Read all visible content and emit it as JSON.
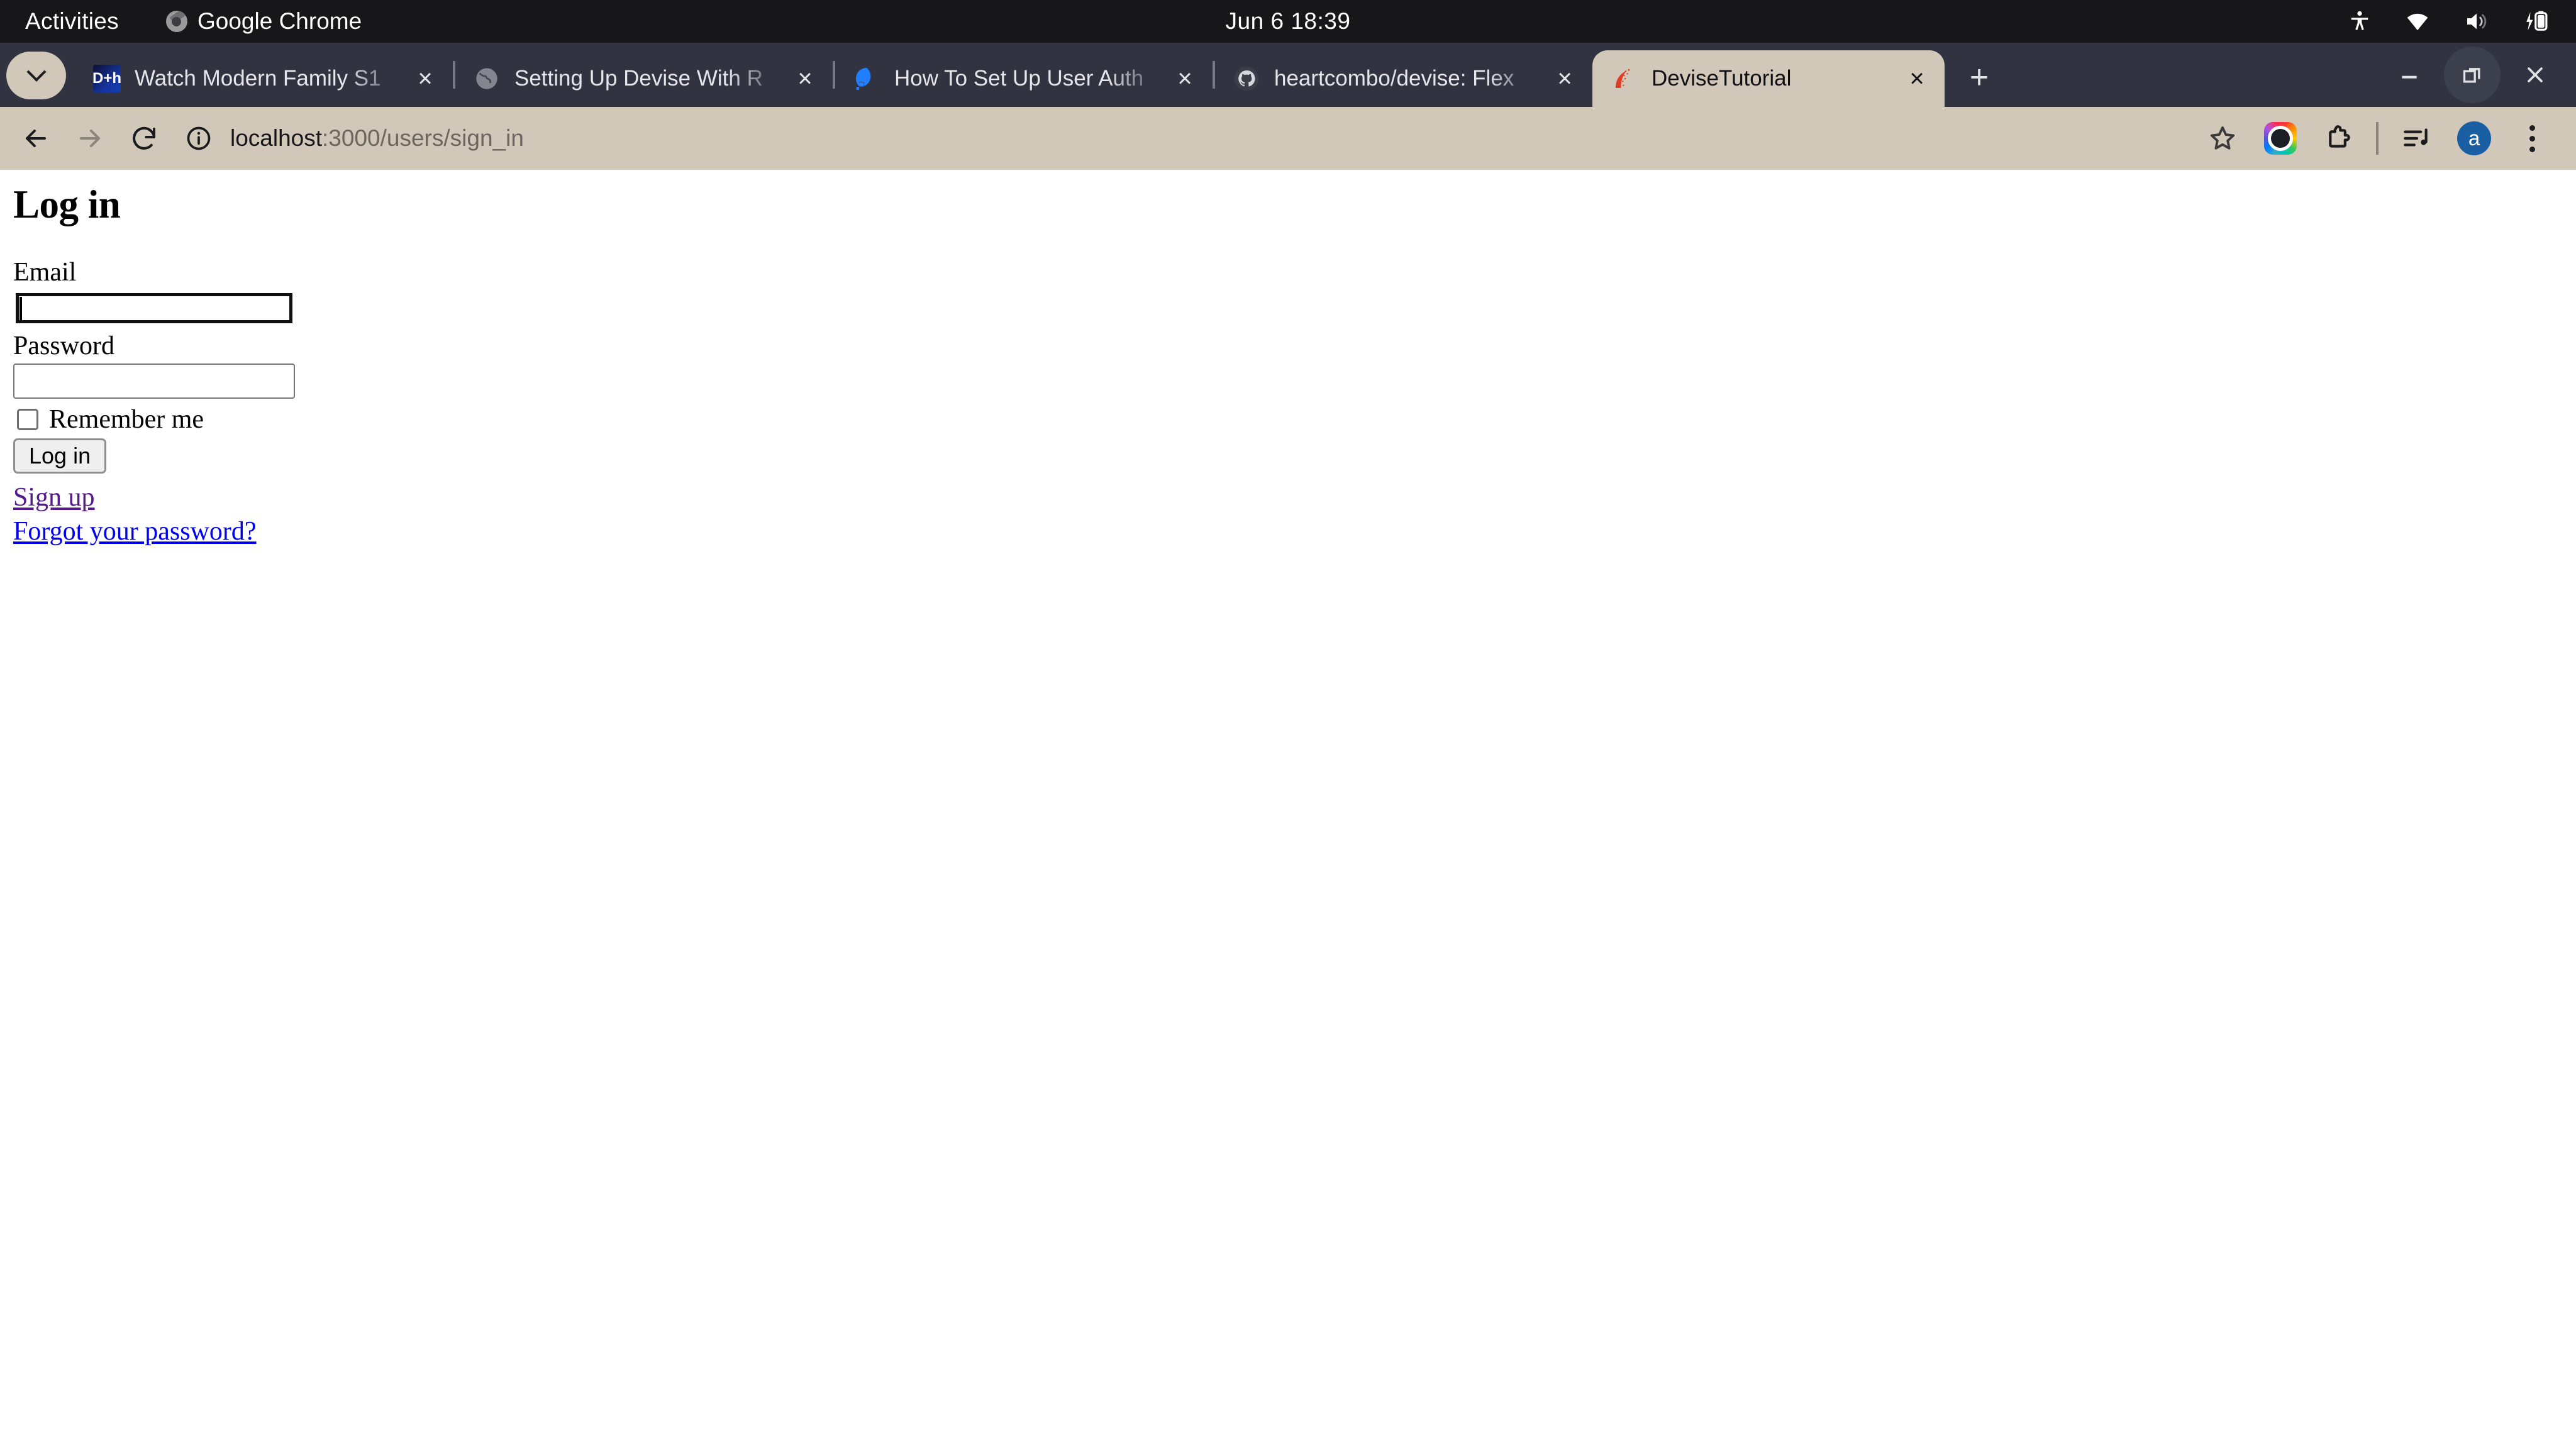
{
  "desktop": {
    "activities_label": "Activities",
    "app_name": "Google Chrome",
    "clock": "Jun 6  18:39",
    "tray": {
      "accessibility": "accessibility-icon",
      "network": "wifi-icon",
      "volume": "volume-icon",
      "battery": "battery-charging-icon"
    }
  },
  "browser": {
    "tab_search_icon": "chevron-down-icon",
    "new_tab_label": "+",
    "tabs": [
      {
        "title": "Watch Modern Family S1",
        "favicon": "disney-plus-hotstar-favicon",
        "favicon_text": "D+h",
        "active": false,
        "close_label": "×"
      },
      {
        "title": "Setting Up Devise With R",
        "favicon": "globe-favicon",
        "favicon_text": "",
        "active": false,
        "close_label": "×"
      },
      {
        "title": "How To Set Up User Auth",
        "favicon": "digitalocean-favicon",
        "favicon_text": "",
        "active": false,
        "close_label": "×"
      },
      {
        "title": "heartcombo/devise: Flex",
        "favicon": "github-favicon",
        "favicon_text": "",
        "active": false,
        "close_label": "×"
      },
      {
        "title": "DeviseTutorial",
        "favicon": "rails-favicon",
        "favicon_text": "",
        "active": true,
        "close_label": "×"
      }
    ],
    "window_controls": {
      "minimize": "minimize-icon",
      "restore": "restore-icon",
      "close": "close-icon"
    },
    "toolbar": {
      "back": "back-arrow-icon",
      "forward": "forward-arrow-icon",
      "reload": "reload-icon",
      "site_info": "info-circle-icon",
      "url_host": "localhost",
      "url_path": ":3000/users/sign_in",
      "bookmark": "star-icon",
      "extension_lens": "lens-extension-icon",
      "extensions": "puzzle-piece-icon",
      "media_control": "media-playlist-icon",
      "profile_initial": "a",
      "menu": "kebab-menu-icon"
    },
    "colors": {
      "tabstrip_bg": "#313440",
      "active_tab_bg": "#d2c8ba",
      "toolbar_bg": "#d2c8ba",
      "avatar_blue": "#1a5fa4",
      "gnome_bar_bg": "#17171a"
    }
  },
  "page": {
    "heading": "Log in",
    "email": {
      "label": "Email",
      "value": "",
      "focused": true
    },
    "password": {
      "label": "Password",
      "value": "",
      "focused": false
    },
    "remember": {
      "label": "Remember me",
      "checked": false
    },
    "submit_label": "Log in",
    "links": [
      {
        "text": "Sign up",
        "state": "visited",
        "color": "#551a8b"
      },
      {
        "text": "Forgot your password?",
        "state": "unvisited",
        "color": "#0000ee"
      }
    ]
  }
}
